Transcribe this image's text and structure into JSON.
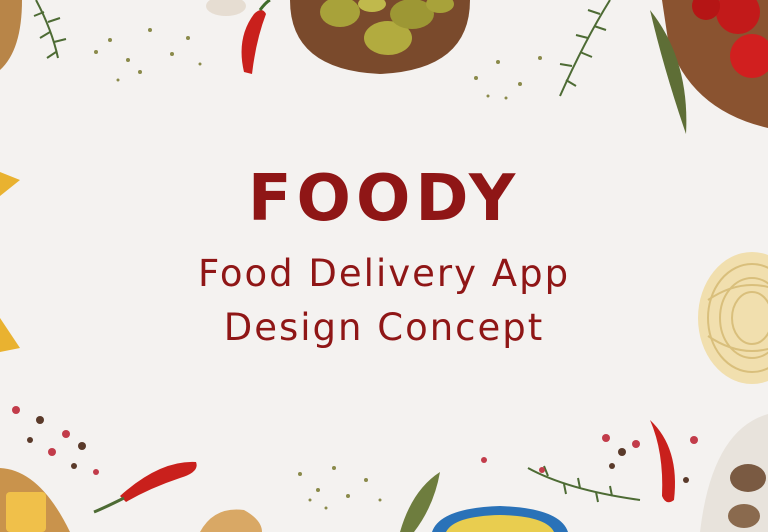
{
  "brand": "FOODY",
  "subtitle_line1": "Food Delivery App",
  "subtitle_line2": "Design Concept",
  "colors": {
    "title": "#8f1616",
    "background": "#f4f2f0"
  },
  "decorations": [
    "olives-bowl",
    "tomatoes-bowl",
    "red-chili-pepper",
    "rosemary-sprig",
    "bay-leaf",
    "dried-herbs",
    "peppercorns",
    "pasta-nest",
    "cheese",
    "mushrooms-bowl",
    "olive-oil-bowl",
    "bread"
  ]
}
